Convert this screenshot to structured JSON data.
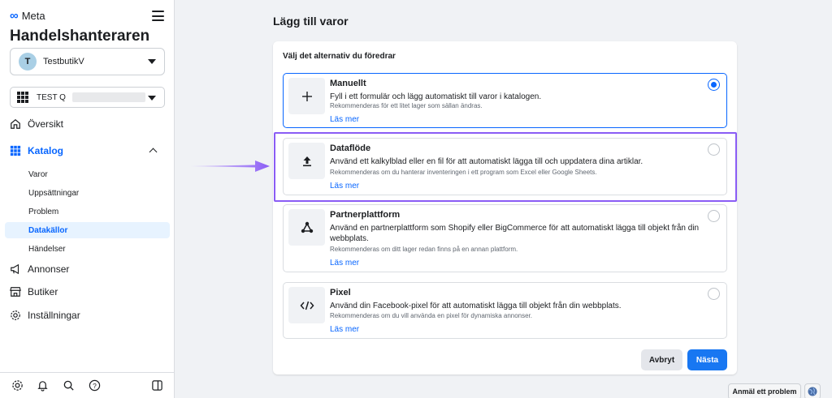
{
  "sidebar": {
    "brand": "Meta",
    "app_title": "Handelshanteraren",
    "account": {
      "initial": "T",
      "name": "TestbutikV"
    },
    "catalog": {
      "name": "TEST Q"
    },
    "nav": {
      "overview": "Översikt",
      "catalog": "Katalog",
      "sub_items": [
        "Varor",
        "Uppsättningar",
        "Problem",
        "Datakällor",
        "Händelser"
      ],
      "ads": "Annonser",
      "shops": "Butiker",
      "settings": "Inställningar"
    }
  },
  "main": {
    "title": "Lägg till varor",
    "subtitle": "Välj det alternativ du föredrar",
    "options": [
      {
        "title": "Manuellt",
        "desc": "Fyll i ett formulär och lägg automatiskt till varor i katalogen.",
        "rec": "Rekommenderas för ett litet lager som sällan ändras.",
        "link": "Läs mer",
        "icon": "plus-icon",
        "selected": true
      },
      {
        "title": "Dataflöde",
        "desc": "Använd ett kalkylblad eller en fil för att automatiskt lägga till och uppdatera dina artiklar.",
        "rec": "Rekommenderas om du hanterar inventeringen i ett program som Excel eller Google Sheets.",
        "link": "Läs mer",
        "icon": "upload-icon",
        "selected": false
      },
      {
        "title": "Partnerplattform",
        "desc": "Använd en partnerplattform som Shopify eller BigCommerce för att automatiskt lägga till objekt från din webbplats.",
        "rec": "Rekommenderas om ditt lager redan finns på en annan plattform.",
        "link": "Läs mer",
        "icon": "partner-nodes-icon",
        "selected": false
      },
      {
        "title": "Pixel",
        "desc": "Använd din Facebook-pixel för att automatiskt lägga till objekt från din webbplats.",
        "rec": "Rekommenderas om du vill använda en pixel för dynamiska annonser.",
        "link": "Läs mer",
        "icon": "code-icon",
        "selected": false
      }
    ],
    "cancel": "Avbryt",
    "next": "Nästa"
  },
  "footer": {
    "report": "Anmäl ett problem"
  },
  "colors": {
    "accent": "#0866ff",
    "primary_button": "#1877f2",
    "highlight": "#8a5cf5"
  }
}
